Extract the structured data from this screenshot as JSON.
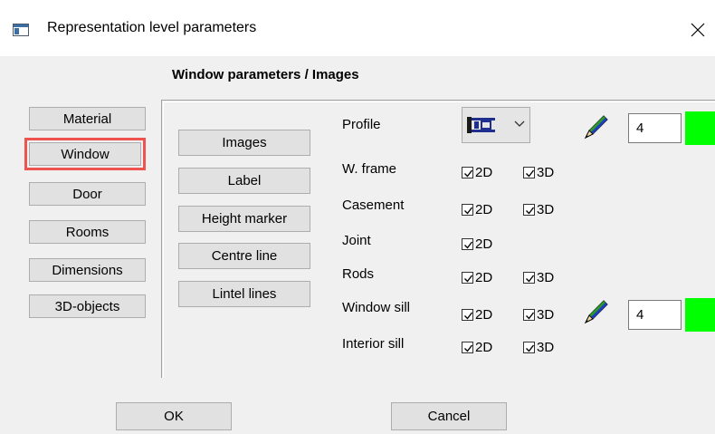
{
  "window": {
    "title": "Representation level parameters",
    "app_icon": "window-app-icon",
    "close_icon": "close-icon"
  },
  "group_title": "Window parameters / Images",
  "categories": [
    {
      "label": "Material",
      "selected": false
    },
    {
      "label": "Window",
      "selected": true
    },
    {
      "label": "Door",
      "selected": false
    },
    {
      "label": "Rooms",
      "selected": false
    },
    {
      "label": "Dimensions",
      "selected": false
    },
    {
      "label": "3D-objects",
      "selected": false
    }
  ],
  "subsections": [
    "Images",
    "Label",
    "Height marker",
    "Centre line",
    "Lintel lines"
  ],
  "rows": [
    {
      "label": "Profile"
    },
    {
      "label": "W. frame",
      "checkboxes": [
        {
          "label": "2D",
          "checked": true
        },
        {
          "label": "3D",
          "checked": true
        }
      ]
    },
    {
      "label": "Casement",
      "checkboxes": [
        {
          "label": "2D",
          "checked": true
        },
        {
          "label": "3D",
          "checked": true
        }
      ]
    },
    {
      "label": "Joint",
      "checkboxes": [
        {
          "label": "2D",
          "checked": true
        }
      ]
    },
    {
      "label": "Rods",
      "checkboxes": [
        {
          "label": "2D",
          "checked": true
        },
        {
          "label": "3D",
          "checked": true
        }
      ]
    },
    {
      "label": "Window sill",
      "checkboxes": [
        {
          "label": "2D",
          "checked": true
        },
        {
          "label": "3D",
          "checked": true
        }
      ]
    },
    {
      "label": "Interior sill",
      "checkboxes": [
        {
          "label": "2D",
          "checked": true
        },
        {
          "label": "3D",
          "checked": true
        }
      ]
    }
  ],
  "profile_pen": {
    "value": "4",
    "color": "#00ff00",
    "icon": "pencil-icon"
  },
  "sill_pen": {
    "value": "4",
    "color": "#00ff00",
    "icon": "pencil-icon"
  },
  "buttons": {
    "ok": "OK",
    "cancel": "Cancel"
  },
  "colors": {
    "selection_outline": "#ef5350",
    "pen_swatch": "#00ff00"
  }
}
